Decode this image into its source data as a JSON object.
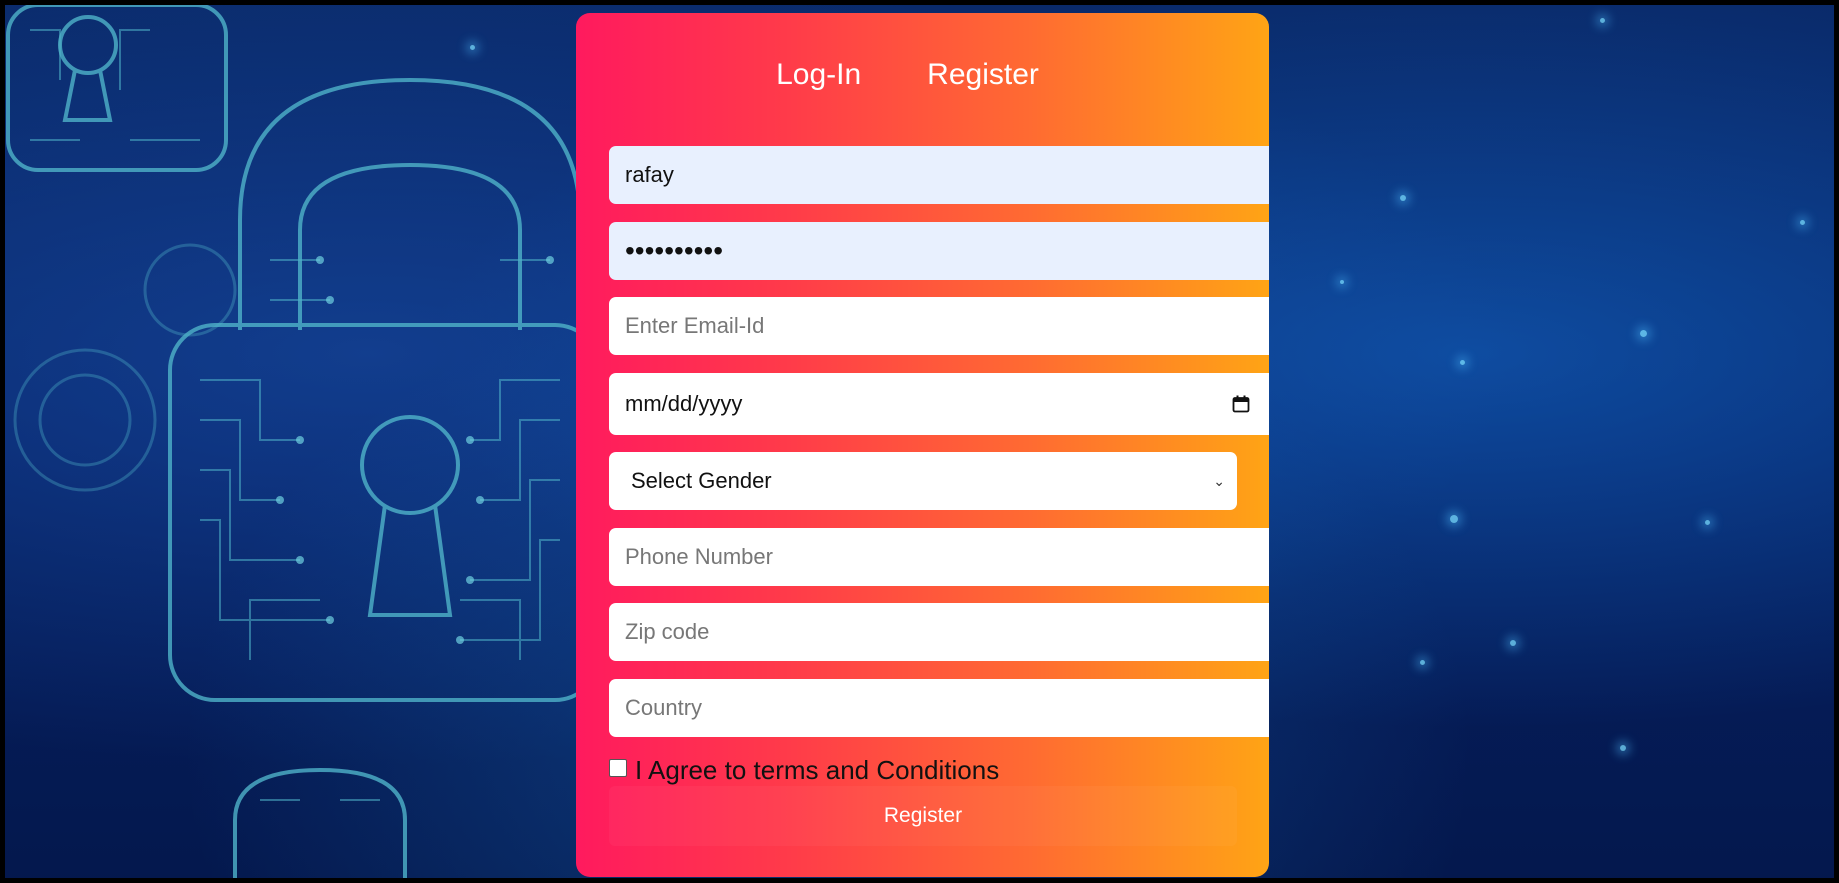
{
  "tabs": {
    "login": "Log-In",
    "register": "Register"
  },
  "form": {
    "username_value": "rafay",
    "password_value": "••••••••••",
    "email_placeholder": "Enter Email-Id",
    "date_placeholder": "mm/dd/yyyy",
    "gender_selected": "Select Gender",
    "phone_placeholder": "Phone Number",
    "zip_placeholder": "Zip code",
    "country_placeholder": "Country",
    "terms_label": "I Agree to terms and Conditions",
    "submit_label": "Register"
  },
  "icons": {
    "calendar": "calendar-icon",
    "dropdown": "chevron-down-icon",
    "background": "padlock-circuit-icon"
  },
  "colors": {
    "card_gradient_start": "#ff1a5e",
    "card_gradient_end": "#ffa415",
    "autofill_bg": "#e8f0fe",
    "background_blue": "#062062"
  }
}
